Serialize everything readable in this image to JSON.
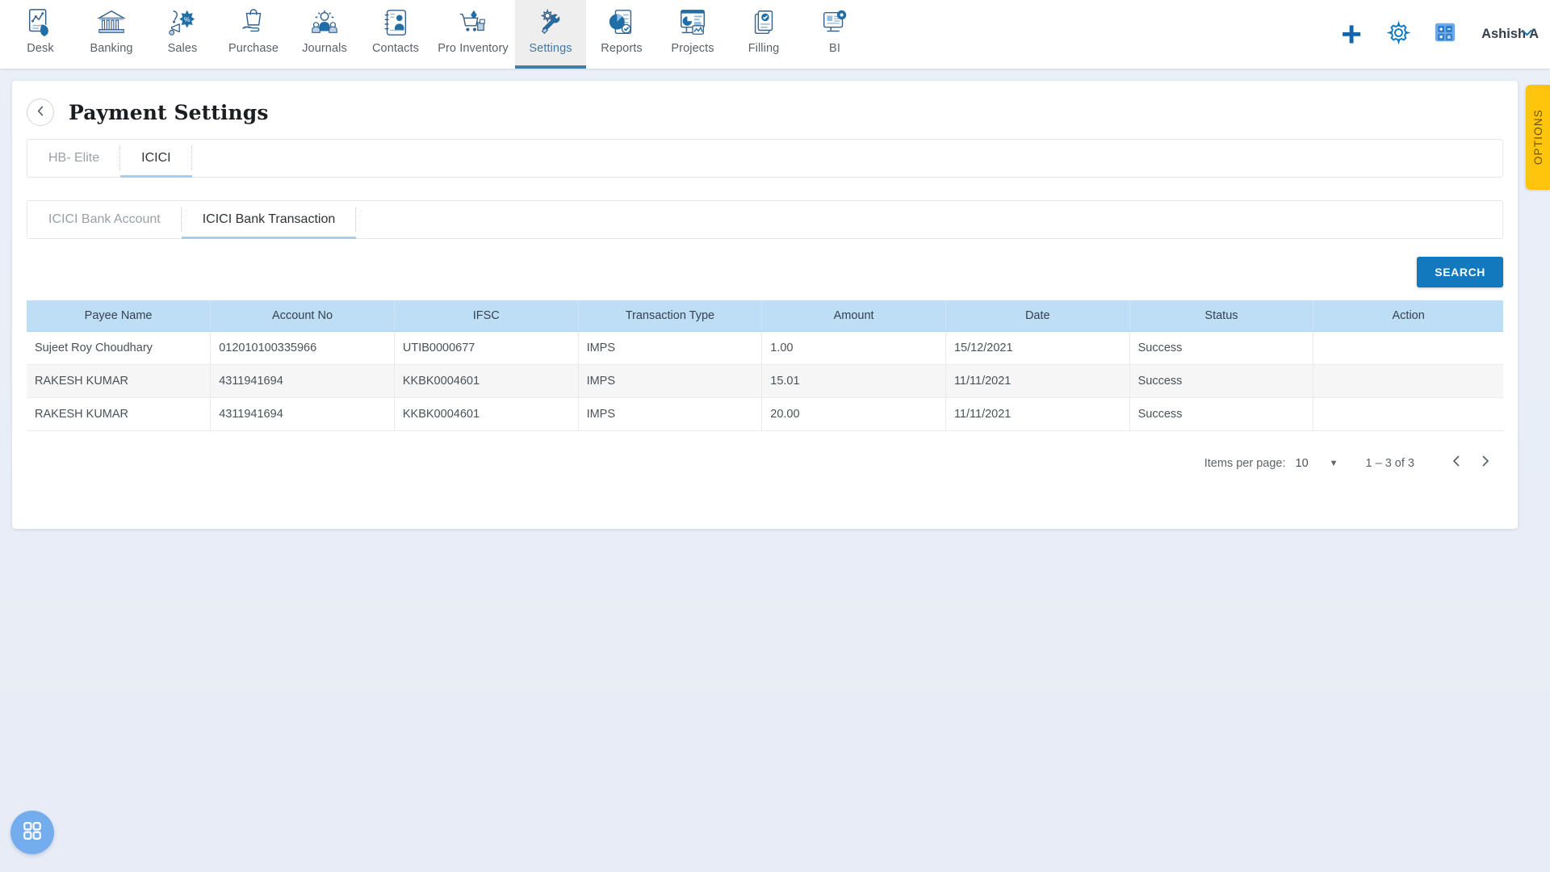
{
  "nav": {
    "items": [
      {
        "label": "Desk",
        "icon": "desk-analytics-icon",
        "active": false
      },
      {
        "label": "Banking",
        "icon": "bank-building-icon",
        "active": false
      },
      {
        "label": "Sales",
        "icon": "sales-megaphone-icon",
        "active": false
      },
      {
        "label": "Purchase",
        "icon": "purchase-bag-hand-icon",
        "active": false
      },
      {
        "label": "Journals",
        "icon": "journals-people-icon",
        "active": false
      },
      {
        "label": "Contacts",
        "icon": "contacts-card-icon",
        "active": false
      },
      {
        "label": "Pro Inventory",
        "icon": "inventory-cart-icon",
        "active": false
      },
      {
        "label": "Settings",
        "icon": "settings-gear-wrench-icon",
        "active": true
      },
      {
        "label": "Reports",
        "icon": "reports-piechart-icon",
        "active": false
      },
      {
        "label": "Projects",
        "icon": "projects-dashboard-icon",
        "active": false
      },
      {
        "label": "Filling",
        "icon": "filling-documents-icon",
        "active": false
      },
      {
        "label": "BI",
        "icon": "bi-monitor-gear-icon",
        "active": false
      }
    ],
    "actions": {
      "add_label": "+",
      "add_icon": "plus-icon",
      "settings_icon": "gear-icon",
      "calculator_icon": "calculator-icon"
    },
    "user": {
      "name": "Ashish A",
      "caret_icon": "chevron-down-icon"
    }
  },
  "options_tab": {
    "label": "OPTIONS"
  },
  "page": {
    "back_icon": "chevron-left-icon",
    "title": "Payment Settings"
  },
  "bank_tabs": {
    "items": [
      {
        "label": "HB- Elite",
        "active": false
      },
      {
        "label": "ICICI",
        "active": true
      }
    ]
  },
  "sub_tabs": {
    "items": [
      {
        "label": "ICICI Bank Account",
        "active": false
      },
      {
        "label": "ICICI Bank Transaction",
        "active": true
      }
    ]
  },
  "toolbar": {
    "search_label": "SEARCH"
  },
  "table": {
    "columns": [
      "Payee Name",
      "Account No",
      "IFSC",
      "Transaction Type",
      "Amount",
      "Date",
      "Status",
      "Action"
    ],
    "rows": [
      {
        "payee_name": "Sujeet Roy Choudhary",
        "account_no": "012010100335966",
        "ifsc": "UTIB0000677",
        "transaction_type": "IMPS",
        "amount": "1.00",
        "date": "15/12/2021",
        "status": "Success",
        "action": ""
      },
      {
        "payee_name": "RAKESH KUMAR",
        "account_no": "4311941694",
        "ifsc": "KKBK0004601",
        "transaction_type": "IMPS",
        "amount": "15.01",
        "date": "11/11/2021",
        "status": "Success",
        "action": ""
      },
      {
        "payee_name": "RAKESH KUMAR",
        "account_no": "4311941694",
        "ifsc": "KKBK0004601",
        "transaction_type": "IMPS",
        "amount": "20.00",
        "date": "11/11/2021",
        "status": "Success",
        "action": ""
      }
    ]
  },
  "paginator": {
    "items_per_page_label": "Items per page:",
    "items_per_page_value": "10",
    "caret_icon": "caret-down-icon",
    "range_label": "1 – 3 of 3",
    "prev_icon": "chevron-left-icon",
    "next_icon": "chevron-right-icon"
  },
  "fab": {
    "icon": "grid-apps-icon"
  },
  "colors": {
    "accent": "#1379be",
    "nav_active": "#3f7fae",
    "table_header": "#bedef5",
    "options_tab": "#ffc40c",
    "fab": "#74aded",
    "page_background": "#e9eef8"
  }
}
